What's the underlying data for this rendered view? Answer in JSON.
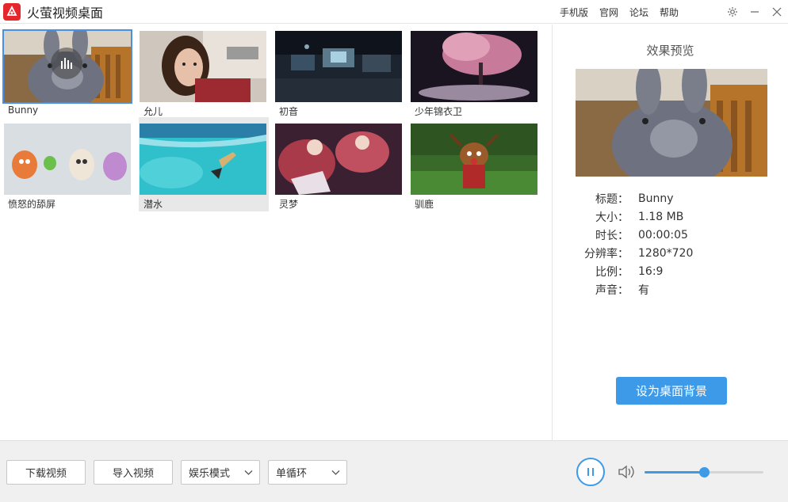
{
  "app": {
    "title": "火萤视频桌面"
  },
  "top_links": [
    "手机版",
    "官网",
    "论坛",
    "帮助"
  ],
  "videos": [
    {
      "label": "Bunny",
      "selected": true
    },
    {
      "label": "允儿"
    },
    {
      "label": "初音"
    },
    {
      "label": "少年锦衣卫"
    },
    {
      "label": "愤怒的舔屏"
    },
    {
      "label": "潜水",
      "hovered": true
    },
    {
      "label": "灵梦"
    },
    {
      "label": "驯鹿"
    }
  ],
  "preview": {
    "title": "效果预览",
    "info": [
      {
        "key": "标题：",
        "value": "Bunny"
      },
      {
        "key": "大小：",
        "value": "1.18 MB"
      },
      {
        "key": "时长：",
        "value": "00:00:05"
      },
      {
        "key": "分辨率：",
        "value": "1280*720"
      },
      {
        "key": "比例：",
        "value": "16:9"
      },
      {
        "key": "声音：",
        "value": "有"
      }
    ],
    "set_bg_label": "设为桌面背景"
  },
  "bottom": {
    "download_label": "下载视频",
    "import_label": "导入视频",
    "mode_select": "娱乐模式",
    "loop_select": "单循环",
    "volume": 0.5
  },
  "colors": {
    "accent": "#3d9ae8",
    "brand": "#e5272d",
    "selected_border": "#4a90e2"
  }
}
